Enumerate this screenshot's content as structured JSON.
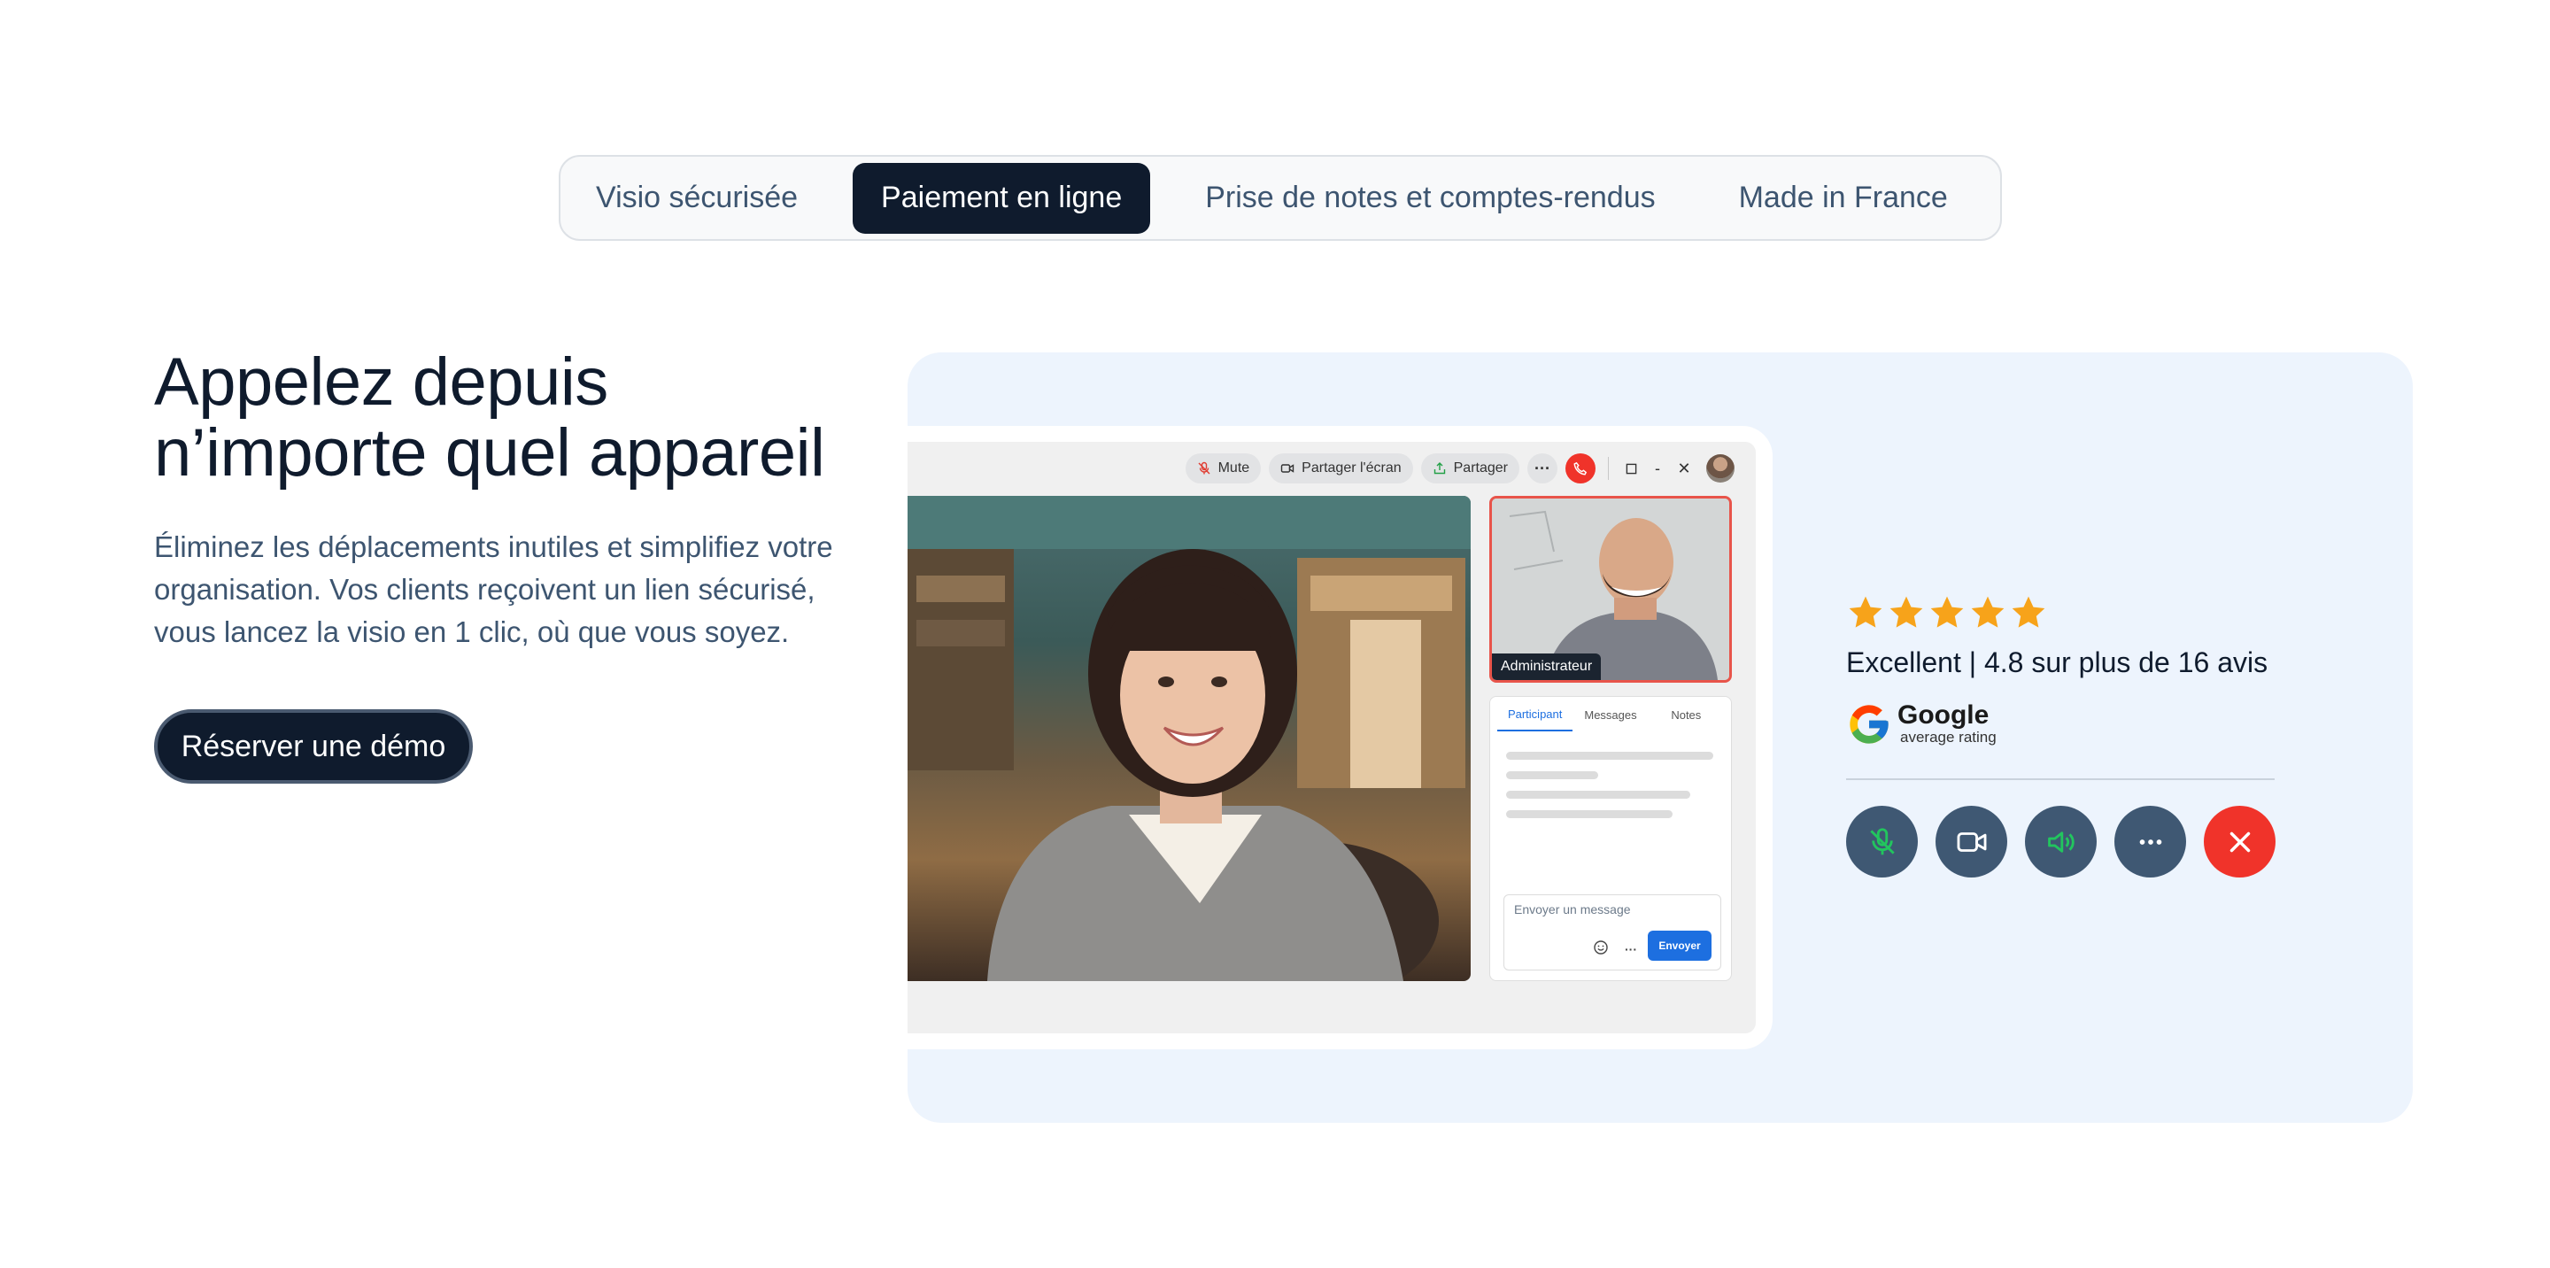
{
  "tabs": [
    {
      "label": "Visio sécurisée",
      "active": false
    },
    {
      "label": "Paiement en ligne",
      "active": true
    },
    {
      "label": "Prise de notes et comptes-rendus",
      "active": false
    },
    {
      "label": "Made in France",
      "active": false
    }
  ],
  "hero": {
    "title": "Appelez depuis n’importe quel appareil",
    "description": "Éliminez les déplacements inutiles et simplifiez votre organisation. Vos clients reçoivent un lien sécurisé, vous lancez la visio en 1 clic, où que vous soyez.",
    "cta_label": "Réserver une démo"
  },
  "call_window": {
    "toolbar": {
      "mute_label": "Mute",
      "share_screen_label": "Partager l'écran",
      "share_label": "Partager",
      "more_label": "···",
      "minimize_label": "-",
      "close_label": "✕"
    },
    "participant_label": "Administrateur",
    "chat_tabs": [
      "Participant",
      "Messages",
      "Notes"
    ],
    "message_placeholder": "Envoyer un message",
    "send_label": "Envoyer",
    "more_label": "···"
  },
  "rating": {
    "stars": 5,
    "text": "Excellent | 4.8 sur plus de 16 avis",
    "provider": "Google",
    "provider_sub": "average rating"
  },
  "controls": [
    "mic-off-icon",
    "video-camera-icon",
    "speaker-icon",
    "more-icon",
    "end-call-icon"
  ],
  "colors": {
    "dark": "#0f1b2d",
    "muted_text": "#3d5570",
    "panel_bg": "#edf4fd",
    "control_bg": "#3f5873",
    "danger": "#f0332a",
    "star": "#f7a31a",
    "accent_blue": "#1d6fe0",
    "accent_green": "#22c55e"
  }
}
